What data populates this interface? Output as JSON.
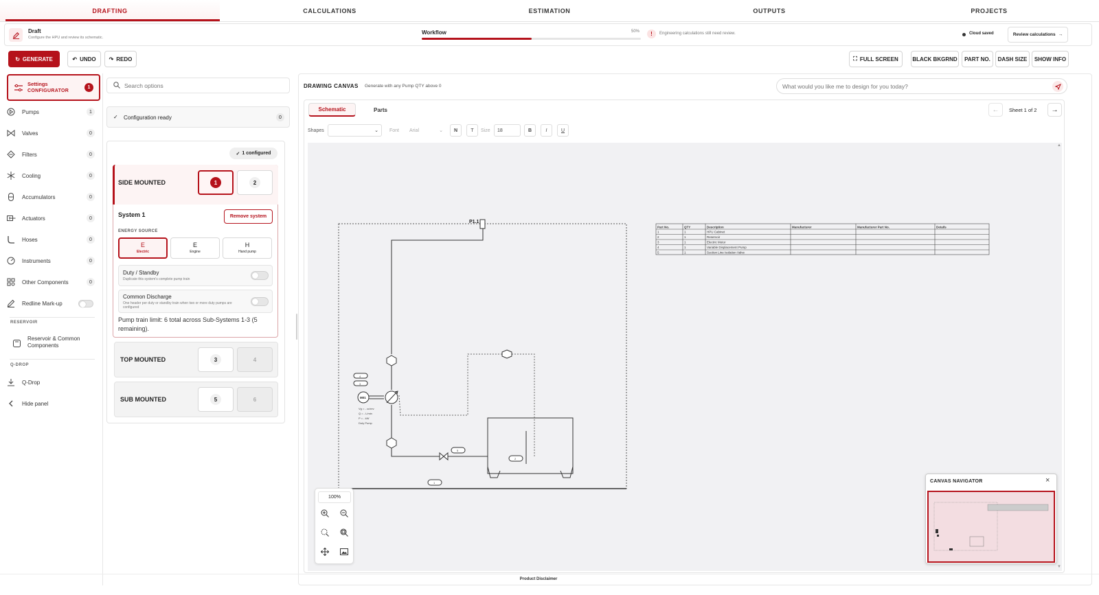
{
  "nav": {
    "tabs": [
      {
        "label": "DRAFTING",
        "active": true
      },
      {
        "label": "CALCULATIONS"
      },
      {
        "label": "ESTIMATION"
      },
      {
        "label": "OUTPUTS"
      },
      {
        "label": "PROJECTS"
      }
    ]
  },
  "status": {
    "title": "Draft",
    "subtitle": "Configure the HPU and review its schematic.",
    "workflow_label": "Workflow",
    "workflow_pct_text": "50%",
    "workflow_progress": 0.5,
    "warning": "Engineering calculations still need review.",
    "saved": "Cloud saved",
    "review_button": "Review calculations"
  },
  "toolbar": {
    "generate": "GENERATE",
    "undo": "UNDO",
    "redo": "REDO",
    "full_screen": "FULL SCREEN",
    "black_bkgrnd": "BLACK BKGRND",
    "part_no": "PART NO.",
    "dash_size": "DASH SIZE",
    "show_info": "SHOW INFO"
  },
  "sidebar": {
    "active": {
      "line1": "Settings",
      "line2": "CONFIGURATOR",
      "badge": "1"
    },
    "items": [
      {
        "label": "Pumps",
        "count": "1"
      },
      {
        "label": "Valves",
        "count": "0"
      },
      {
        "label": "Filters",
        "count": "0"
      },
      {
        "label": "Cooling",
        "count": "0"
      },
      {
        "label": "Accumulators",
        "count": "0"
      },
      {
        "label": "Actuators",
        "count": "0"
      },
      {
        "label": "Hoses",
        "count": "0"
      },
      {
        "label": "Instruments",
        "count": "0"
      },
      {
        "label": "Other Components",
        "count": "0"
      }
    ],
    "redline": "Redline Mark-up",
    "reservoir_section": "RESERVOIR",
    "reservoir_item": "Reservoir & Common Components",
    "qdrop_section": "Q-DROP",
    "qdrop_item": "Q-Drop",
    "hide_panel": "Hide panel"
  },
  "panel": {
    "search_placeholder": "Search options",
    "config_ready": "Configuration ready",
    "config_count": "0",
    "configured_badge": "1 configured",
    "side": {
      "label": "SIDE MOUNTED",
      "opt1": "1",
      "opt2": "2"
    },
    "system": {
      "title": "System 1",
      "remove": "Remove system",
      "energy_label": "ENERGY SOURCE",
      "energy": [
        {
          "letter": "E",
          "label": "Electric",
          "selected": true
        },
        {
          "letter": "E",
          "label": "Engine"
        },
        {
          "letter": "H",
          "label": "Hand pump"
        }
      ],
      "duty_title": "Duty / Standby",
      "duty_desc": "Duplicate this system's complete pump train",
      "common_title": "Common Discharge",
      "common_desc": "One header per duty or standby train when two or more duty pumps are configured",
      "limit": "Pump train limit: 6 total across Sub-Systems 1-3 (5 remaining)."
    },
    "top": {
      "label": "TOP MOUNTED",
      "opt1": "3",
      "opt2": "4"
    },
    "sub": {
      "label": "SUB MOUNTED",
      "opt1": "5",
      "opt2": "6"
    }
  },
  "canvas": {
    "title": "DRAWING CANVAS",
    "subtitle": "Generate with any Pump QTY above 0",
    "ai_placeholder": "What would you like me to design for you today?",
    "tabs": [
      {
        "label": "Schematic",
        "active": true
      },
      {
        "label": "Parts"
      }
    ],
    "sheet": "Sheet 1 of 2",
    "format": {
      "shapes": "Shapes",
      "font": "Font",
      "font_value": "Arial",
      "n": "N",
      "t": "T",
      "size": "Size",
      "size_value": "18",
      "b": "B",
      "i": "I",
      "u": "U"
    },
    "zoom": "100%",
    "schematic": {
      "tag": "P1.1",
      "motor": "M01",
      "pump_lines": [
        "Vg = - cc/rev",
        "Q = - L/min",
        "P = - kW",
        "Duty Pump"
      ],
      "labels": [
        "4",
        "3",
        "5",
        "2",
        "1"
      ]
    },
    "parts_table": {
      "headers": [
        "Part No.",
        "QTY",
        "Description",
        "Manufacturer",
        "Manufacturer Part No.",
        "Details"
      ],
      "rows": [
        [
          "1",
          "1",
          "HPU Cabinet",
          "",
          "",
          ""
        ],
        [
          "2",
          "1",
          "Reservoir",
          "",
          "",
          ""
        ],
        [
          "3",
          "1",
          "Electric Motor",
          "",
          "",
          ""
        ],
        [
          "4",
          "1",
          "Variable Displacement Pump",
          "",
          "",
          ""
        ],
        [
          "5",
          "1",
          "Suction Line Isolation Valve",
          "",
          "",
          ""
        ]
      ]
    },
    "navigator": "CANVAS NAVIGATOR"
  },
  "footer": "Product Disclaimer",
  "colors": {
    "accent": "#b5121b"
  }
}
